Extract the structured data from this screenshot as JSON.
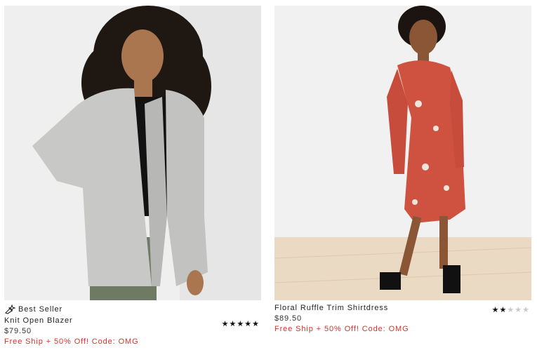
{
  "products": [
    {
      "badge": "Best Seller",
      "badge_icon": "sparkle-tag-icon",
      "name": "Knit Open Blazer",
      "price": "$79.50",
      "promo": "Free Ship + 50% Off! Code: OMG",
      "rating": 5,
      "rating_max": 5
    },
    {
      "name": "Floral Ruffle Trim Shirtdress",
      "price": "$89.50",
      "promo": "Free Ship + 50% Off! Code: OMG",
      "rating": 2,
      "rating_max": 5
    }
  ],
  "colors": {
    "promo": "#d2342a",
    "star_on": "#111111",
    "star_off": "#c9c9c9"
  }
}
